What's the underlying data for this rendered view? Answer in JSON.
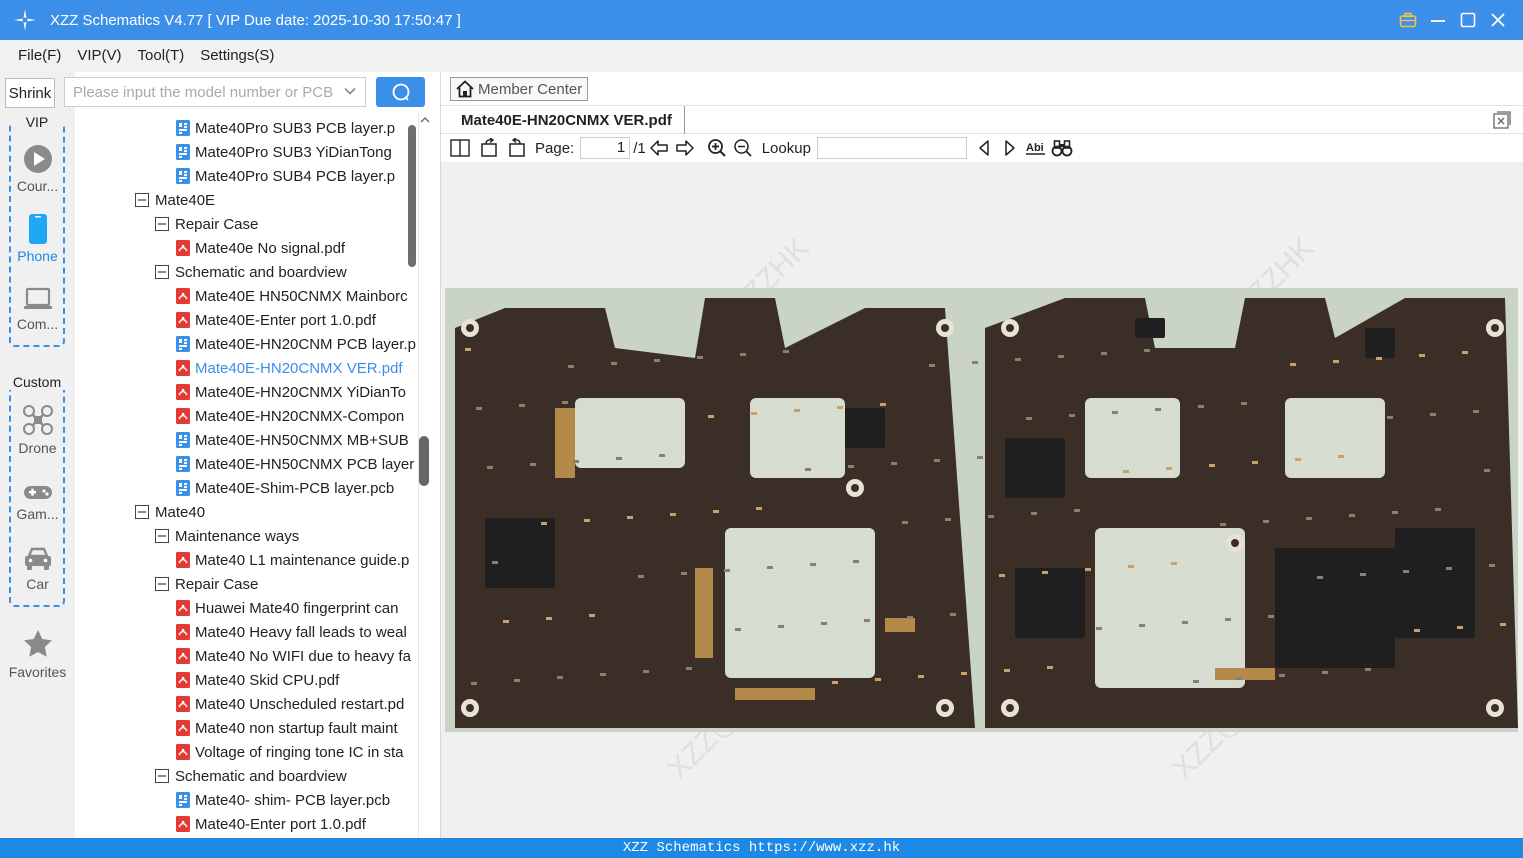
{
  "window": {
    "title": "XZZ Schematics V4.77 [ VIP Due date: 2025-10-30 17:50:47 ]"
  },
  "menu": [
    "File(F)",
    "VIP(V)",
    "Tool(T)",
    "Settings(S)"
  ],
  "sidebar": {
    "shrink_label": "Shrink",
    "vip_label": "VIP",
    "custom_label": "Custom",
    "items": [
      {
        "label": "Cour...",
        "icon": "play-circle-icon"
      },
      {
        "label": "Phone",
        "icon": "phone-icon"
      },
      {
        "label": "Com...",
        "icon": "laptop-icon"
      },
      {
        "label": "Drone",
        "icon": "drone-icon"
      },
      {
        "label": "Gam...",
        "icon": "gamepad-icon"
      },
      {
        "label": "Car",
        "icon": "car-icon"
      },
      {
        "label": "Favorites",
        "icon": "star-icon"
      }
    ],
    "active_item": "Phone"
  },
  "search": {
    "placeholder": "Please input the model number or PCB"
  },
  "tree": [
    {
      "label": "Mate40Pro SUB3 PCB layer.p",
      "type": "pcb",
      "level": 3
    },
    {
      "label": "Mate40Pro SUB3 YiDianTong",
      "type": "pcb",
      "level": 3
    },
    {
      "label": "Mate40Pro SUB4 PCB layer.p",
      "type": "pcb",
      "level": 3
    },
    {
      "label": "Mate40E",
      "type": "folder",
      "level": 1
    },
    {
      "label": "Repair Case",
      "type": "folder",
      "level": 2
    },
    {
      "label": "Mate40e No signal.pdf",
      "type": "pdf",
      "level": 3
    },
    {
      "label": "Schematic and boardview",
      "type": "folder",
      "level": 2
    },
    {
      "label": "Mate40E HN50CNMX Mainborc",
      "type": "pdf",
      "level": 3
    },
    {
      "label": "Mate40E-Enter port 1.0.pdf",
      "type": "pdf",
      "level": 3
    },
    {
      "label": "Mate40E-HN20CNM PCB layer.p",
      "type": "pcb",
      "level": 3
    },
    {
      "label": "Mate40E-HN20CNMX VER.pdf",
      "type": "pdf",
      "level": 3,
      "selected": true
    },
    {
      "label": "Mate40E-HN20CNMX YiDianTo",
      "type": "pdf",
      "level": 3
    },
    {
      "label": "Mate40E-HN20CNMX-Compon",
      "type": "pdf",
      "level": 3
    },
    {
      "label": "Mate40E-HN50CNMX MB+SUB",
      "type": "pcb",
      "level": 3
    },
    {
      "label": "Mate40E-HN50CNMX PCB layer",
      "type": "pcb",
      "level": 3
    },
    {
      "label": "Mate40E-Shim-PCB layer.pcb",
      "type": "pcb",
      "level": 3
    },
    {
      "label": "Mate40",
      "type": "folder",
      "level": 1
    },
    {
      "label": "Maintenance ways",
      "type": "folder",
      "level": 2
    },
    {
      "label": "Mate40 L1 maintenance guide.p",
      "type": "pdf",
      "level": 3
    },
    {
      "label": "Repair Case",
      "type": "folder",
      "level": 2
    },
    {
      "label": "Huawei Mate40 fingerprint can",
      "type": "pdf",
      "level": 3
    },
    {
      "label": "Mate40 Heavy fall leads to weal",
      "type": "pdf",
      "level": 3
    },
    {
      "label": "Mate40 No WIFI due to heavy fa",
      "type": "pdf",
      "level": 3
    },
    {
      "label": "Mate40 Skid CPU.pdf",
      "type": "pdf",
      "level": 3
    },
    {
      "label": "Mate40 Unscheduled restart.pd",
      "type": "pdf",
      "level": 3
    },
    {
      "label": "Mate40 non startup fault maint",
      "type": "pdf",
      "level": 3
    },
    {
      "label": "Voltage of ringing tone IC in sta",
      "type": "pdf",
      "level": 3
    },
    {
      "label": "Schematic and boardview",
      "type": "folder",
      "level": 2
    },
    {
      "label": "Mate40- shim- PCB layer.pcb",
      "type": "pcb",
      "level": 3
    },
    {
      "label": "Mate40-Enter port 1.0.pdf",
      "type": "pdf",
      "level": 3
    }
  ],
  "viewer": {
    "member_center_label": "Member Center",
    "tab_title": "Mate40E-HN20CNMX VER.pdf",
    "page_label": "Page:",
    "page_current": "1",
    "page_total": "/1",
    "lookup_label": "Lookup",
    "lookup_value": "",
    "watermark": "XZZ@XZZHK"
  },
  "statusbar": {
    "text": "XZZ Schematics https://www.xzz.hk"
  },
  "colors": {
    "accent": "#3c8fe8",
    "status": "#1e88e5",
    "pdf": "#e53935",
    "pcb": "#3c8fe8",
    "board": "#3a2e26"
  }
}
